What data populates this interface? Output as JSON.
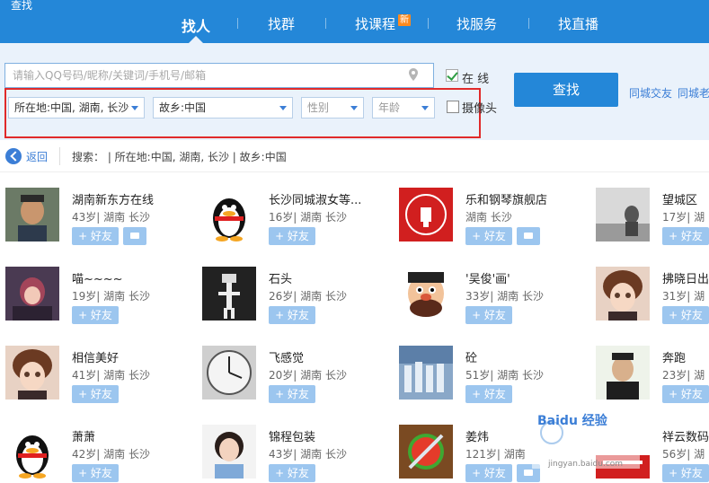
{
  "window": {
    "title": "查找"
  },
  "tabs": [
    {
      "label": "找人",
      "active": true
    },
    {
      "label": "找群"
    },
    {
      "label": "找课程",
      "badge": "新"
    },
    {
      "label": "找服务"
    },
    {
      "label": "找直播"
    }
  ],
  "search": {
    "placeholder": "请输入QQ号码/昵称/关键词/手机号/邮箱",
    "online_label": "在  线",
    "online_checked": true,
    "button_label": "查找",
    "quick_links": [
      "同城交友",
      "同城老"
    ]
  },
  "filters": {
    "location": "所在地:中国, 湖南, 长沙",
    "hometown": "故乡:中国",
    "gender": "性别",
    "age": "年龄",
    "camera_label": "摄像头",
    "camera_checked": false
  },
  "breadcrumb": {
    "back_label": "返回",
    "text": "搜索：  |  所在地:中国, 湖南, 长沙  |  故乡:中国"
  },
  "add_label": "+ 好友",
  "results": [
    {
      "name": "湖南新东方在线",
      "meta": "43岁| 湖南 长沙",
      "chat": true,
      "avatar": "man-photo"
    },
    {
      "name": "长沙同城淑女等...",
      "meta": "16岁| 湖南 长沙",
      "chat": false,
      "avatar": "penguin"
    },
    {
      "name": "乐和钢琴旗舰店",
      "meta": "湖南 长沙",
      "chat": true,
      "avatar": "red-logo"
    },
    {
      "name": "望城区",
      "meta": "17岁| 湖",
      "chat": false,
      "avatar": "gray-photo"
    },
    {
      "name": "喵~~~~",
      "meta": "19岁| 湖南 长沙",
      "chat": false,
      "avatar": "anime-girl"
    },
    {
      "name": "石头",
      "meta": "26岁| 湖南 长沙",
      "chat": false,
      "avatar": "dark-figure"
    },
    {
      "name": "'吴俊'画'",
      "meta": "33岁| 湖南 长沙",
      "chat": false,
      "avatar": "cartoon-man"
    },
    {
      "name": "拂晓日出",
      "meta": "31岁| 湖",
      "chat": false,
      "avatar": "anime-boy"
    },
    {
      "name": "相信美好",
      "meta": "41岁| 湖南 长沙",
      "chat": false,
      "avatar": "anime-boy"
    },
    {
      "name": "飞感觉",
      "meta": "20岁| 湖南 长沙",
      "chat": false,
      "avatar": "clock"
    },
    {
      "name": "砼",
      "meta": "51岁| 湖南 长沙",
      "chat": false,
      "avatar": "blue-crowd"
    },
    {
      "name": "奔跑",
      "meta": "23岁| 湖",
      "chat": false,
      "avatar": "man-portrait"
    },
    {
      "name": "萧萧",
      "meta": "42岁| 湖南 长沙",
      "chat": false,
      "avatar": "penguin"
    },
    {
      "name": "锦程包装",
      "meta": "43岁| 湖南 长沙",
      "chat": false,
      "avatar": "woman"
    },
    {
      "name": "姜炜",
      "meta": "121岁| 湖南",
      "chat": true,
      "avatar": "fruit"
    },
    {
      "name": "祥云数码",
      "meta": "56岁| 湖",
      "chat": false,
      "avatar": "red-sign"
    }
  ],
  "watermark": {
    "text": "Baidu 经验",
    "sub": "jingyan.baidu.com"
  }
}
